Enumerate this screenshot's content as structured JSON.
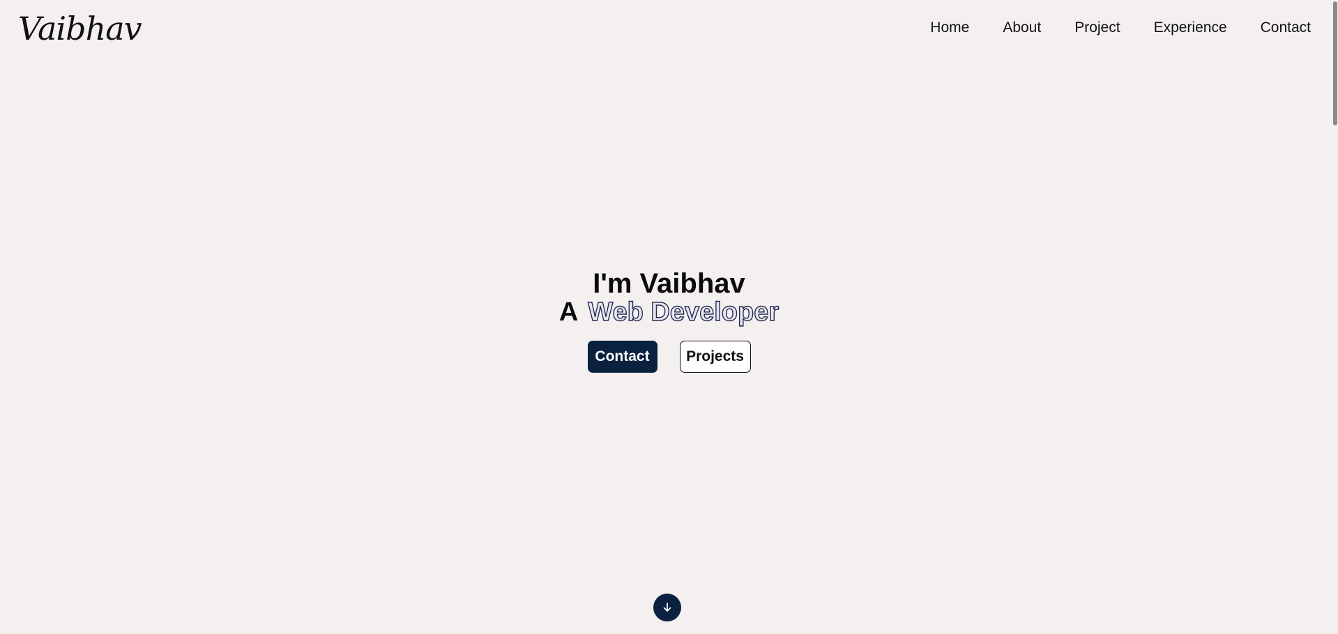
{
  "header": {
    "logo": "Vaibhav",
    "nav": [
      "Home",
      "About",
      "Project",
      "Experience",
      "Contact"
    ]
  },
  "hero": {
    "title": "I'm Vaibhav",
    "subtitle_prefix": "A",
    "subtitle_role": "Web Developer",
    "buttons": {
      "contact": "Contact",
      "projects": "Projects"
    }
  },
  "icons": {
    "scroll_down": "arrow-down-icon"
  },
  "colors": {
    "background": "#f4f0ef",
    "accent": "#0b2140",
    "text": "#111111"
  }
}
